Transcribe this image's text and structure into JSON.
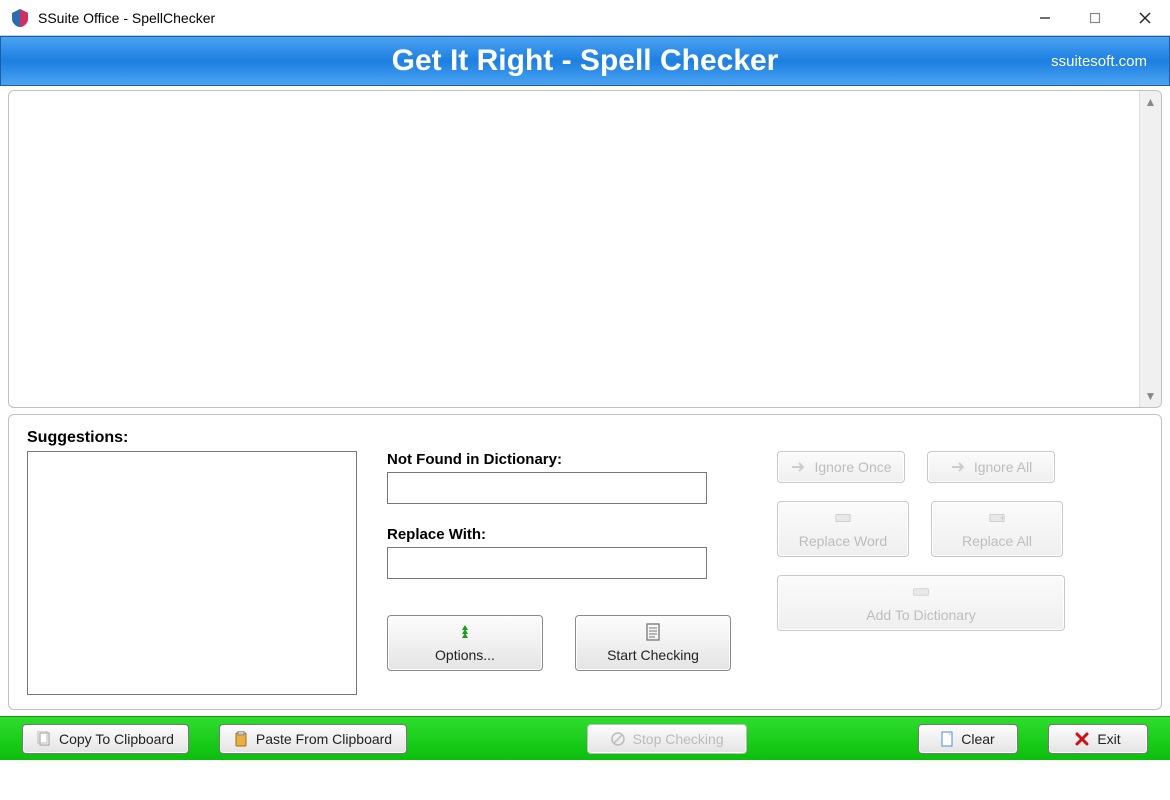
{
  "window": {
    "title": "SSuite Office - SpellChecker"
  },
  "banner": {
    "title": "Get It Right - Spell Checker",
    "link": "ssuitesoft.com"
  },
  "editor": {
    "text": ""
  },
  "labels": {
    "suggestions": "Suggestions:",
    "not_found": "Not Found in Dictionary:",
    "replace_with": "Replace With:"
  },
  "fields": {
    "not_found_value": "",
    "replace_with_value": ""
  },
  "buttons": {
    "ignore_once": "Ignore Once",
    "ignore_all": "Ignore All",
    "replace_word": "Replace Word",
    "replace_all": "Replace All",
    "add_to_dictionary": "Add To Dictionary",
    "options": "Options...",
    "start_checking": "Start Checking",
    "copy_to_clipboard": "Copy To Clipboard",
    "paste_from_clipboard": "Paste From Clipboard",
    "stop_checking": "Stop Checking",
    "clear": "Clear",
    "exit": "Exit"
  }
}
